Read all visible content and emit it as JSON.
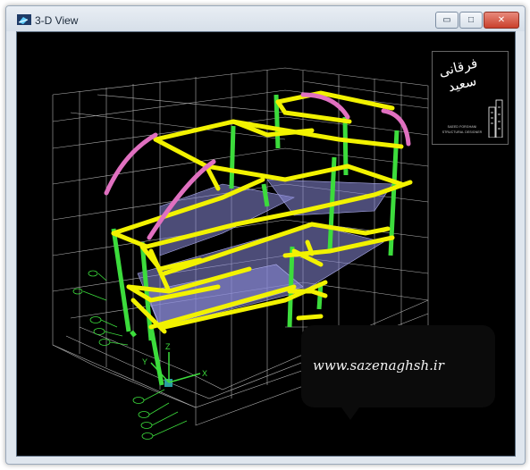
{
  "window": {
    "title": "3-D View",
    "controls": {
      "minimize_glyph": "▭",
      "maximize_glyph": "□",
      "close_glyph": "✕"
    }
  },
  "watermark": {
    "brand_name": "فرقانی سعید",
    "subtitle_line1": "SAEED FORGHANI",
    "subtitle_line2": "STRUCTURAL DESIGNER",
    "website": "www.sazenaghsh.ir"
  },
  "model": {
    "colors": {
      "background": "#000000",
      "grid": "#d0d0d0",
      "beam": "#f2f200",
      "column": "#3cdc3c",
      "arch": "#e070c0",
      "slab": "#8a8ad8"
    },
    "axes": [
      "X",
      "Y",
      "Z"
    ],
    "grid_bubble_count": 9
  },
  "icons": {
    "app": "etabs-3d-icon"
  }
}
